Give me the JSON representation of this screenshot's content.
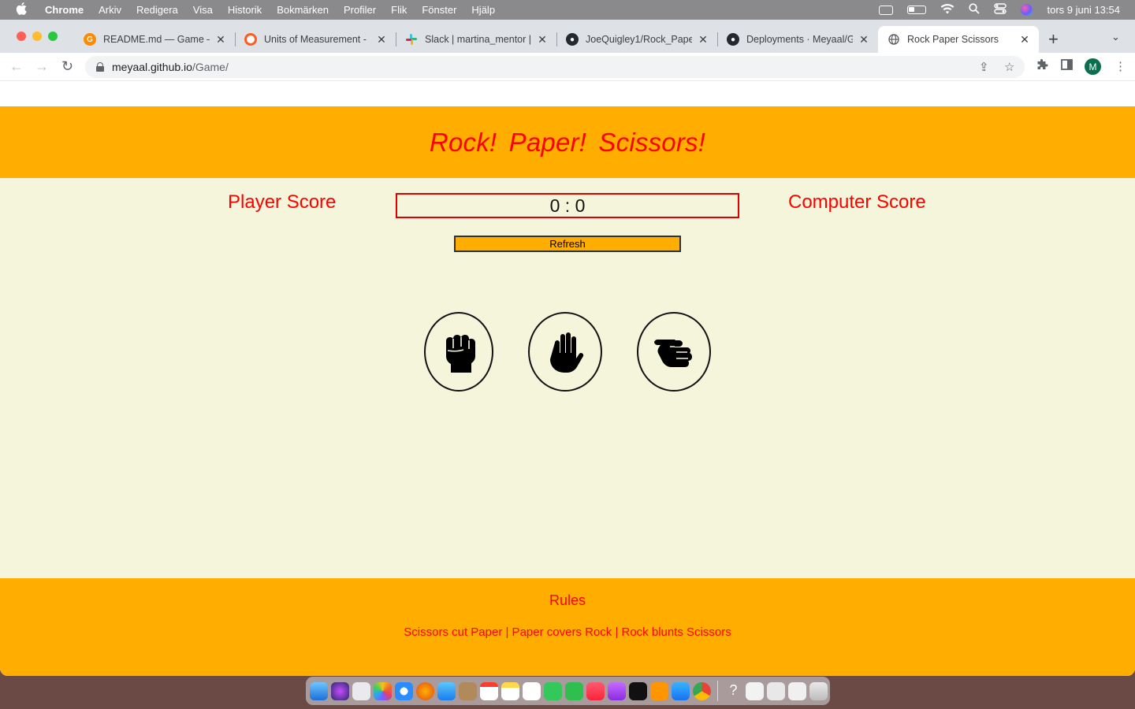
{
  "menubar": {
    "app_name": "Chrome",
    "items": [
      "Arkiv",
      "Redigera",
      "Visa",
      "Historik",
      "Bokmärken",
      "Profiler",
      "Flik",
      "Fönster",
      "Hjälp"
    ],
    "clock": "tors 9 juni  13:54"
  },
  "browser": {
    "tabs": [
      {
        "title": "README.md — Game —",
        "favicon": "gitpod-icon",
        "color": "#ff8a00"
      },
      {
        "title": "Units of Measurement - ",
        "favicon": "units-icon",
        "color": "#ff5a1f"
      },
      {
        "title": "Slack | martina_mentor |",
        "favicon": "slack-icon",
        "color": "#4a154b"
      },
      {
        "title": "JoeQuigley1/Rock_Paper",
        "favicon": "github-icon",
        "color": "#24292f"
      },
      {
        "title": "Deployments · Meyaal/G",
        "favicon": "github-icon",
        "color": "#24292f"
      },
      {
        "title": "Rock Paper Scissors",
        "favicon": "globe-icon",
        "color": "#5f6368"
      }
    ],
    "url_host": "meyaal.github.io",
    "url_path": "/Game/",
    "avatar_letter": "M"
  },
  "game": {
    "title": "Rock!  Paper!  Scissors!",
    "player_label": "Player Score",
    "computer_label": "Computer Score",
    "score": "0 : 0",
    "refresh_label": "Refresh",
    "choices": [
      "rock",
      "paper",
      "scissors"
    ]
  },
  "footer": {
    "rules_title": "Rules",
    "rules_text": "Scissors cut Paper | Paper covers Rock | Rock blunts Scissors"
  },
  "colors": {
    "accent": "#ffae00",
    "text_red": "#ff0000",
    "background": "#f5f5dc"
  }
}
